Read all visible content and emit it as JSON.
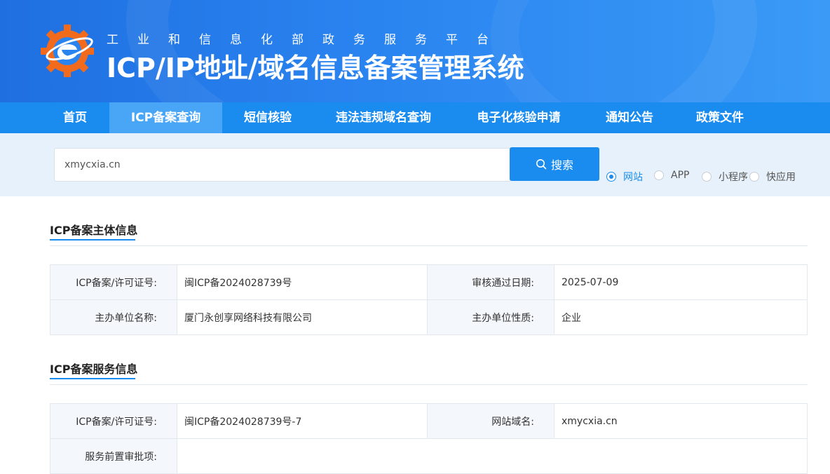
{
  "header": {
    "subtitle": "工业和信息化部政务服务平台",
    "title": "ICP/IP地址/域名信息备案管理系统"
  },
  "nav": {
    "items": [
      {
        "label": "首页"
      },
      {
        "label": "ICP备案查询",
        "active": true
      },
      {
        "label": "短信核验"
      },
      {
        "label": "违法违规域名查询"
      },
      {
        "label": "电子化核验申请"
      },
      {
        "label": "通知公告"
      },
      {
        "label": "政策文件"
      }
    ]
  },
  "search": {
    "value": "xmycxia.cn",
    "button_label": "搜索",
    "types": [
      {
        "label": "网站",
        "checked": true
      },
      {
        "label": "APP"
      },
      {
        "label": "小程序"
      },
      {
        "label": "快应用"
      }
    ]
  },
  "subject": {
    "title": "ICP备案主体信息",
    "rows": [
      {
        "l1": "ICP备案/许可证号:",
        "v1": "闽ICP备2024028739号",
        "l2": "审核通过日期:",
        "v2": "2025-07-09"
      },
      {
        "l1": "主办单位名称:",
        "v1": "厦门永创享网络科技有限公司",
        "l2": "主办单位性质:",
        "v2": "企业"
      }
    ]
  },
  "service": {
    "title": "ICP备案服务信息",
    "rows": [
      {
        "l1": "ICP备案/许可证号:",
        "v1": "闽ICP备2024028739号-7",
        "l2": "网站域名:",
        "v2": "xmycxia.cn"
      },
      {
        "l1": "服务前置审批项:",
        "v1": ""
      }
    ]
  },
  "colors": {
    "primary": "#1a8cf0",
    "nav_active": "#49a6f7",
    "search_band": "#e6f1fb",
    "logo_orange": "#f26a1b"
  }
}
